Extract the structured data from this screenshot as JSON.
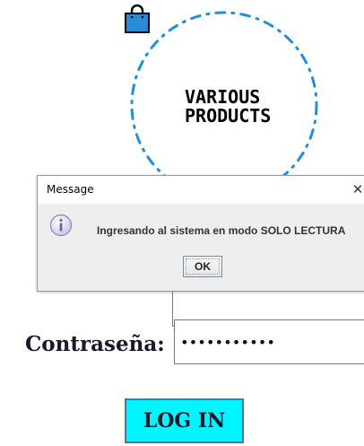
{
  "logo": {
    "line1": "VARIOUS",
    "line2": "PRODUCTS",
    "ring_color": "#1f8fdc",
    "bag_color": "#2b8ad6"
  },
  "login": {
    "password_label": "Contraseña:",
    "password_value": "•••••••••••",
    "login_button": "LOG IN",
    "button_color": "#00f6ff"
  },
  "dialog": {
    "title": "Message",
    "close_glyph": "✕",
    "message": "Ingresando al sistema en modo SOLO LECTURA",
    "ok_label": "OK",
    "icon": "info-icon"
  }
}
